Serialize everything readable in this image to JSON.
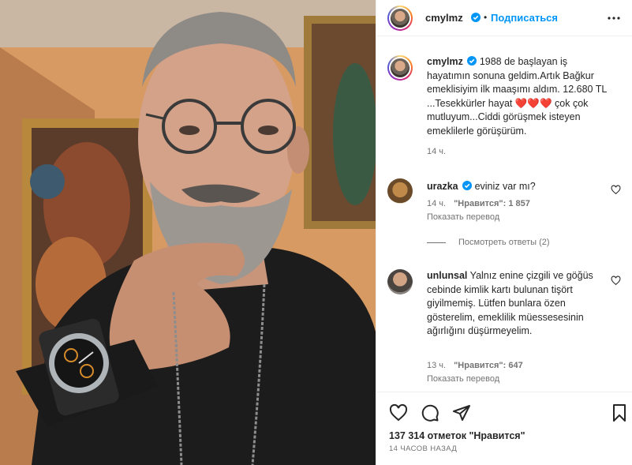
{
  "post": {
    "author": "cmylmz",
    "follow_label": "Подписаться",
    "dot": "•",
    "caption": "1988 de başlayan iş hayatımın sonuna geldim.Artık Bağkur emeklisiyim ilk maaşımı aldım. 12.680 TL ...Tesekkürler hayat ❤️❤️❤️ çok çok mutluyum...Ciddi görüşmek isteyen emeklilerle görüşürüm.",
    "caption_time": "14 ч.",
    "likes": "137 314 отметок \"Нравится\"",
    "posted_ago": "14 ЧАСОВ НАЗАД"
  },
  "comments": [
    {
      "user": "urazka",
      "verified": true,
      "text": "eviniz var mı?",
      "time": "14 ч.",
      "likes": "\"Нравится\": 1 857",
      "translate": "Показать перевод",
      "replies": "Посмотреть ответы (2)"
    },
    {
      "user": "unlunsal",
      "verified": false,
      "text": "Yalnız enine çizgili ve göğüs cebinde kimlik kartı bulunan tişört giyilmemiş. Lütfen bunlara özen gösterelim, emeklilik müessesesinin ağırlığını düşürmeyelim.",
      "time": "13 ч.",
      "likes": "\"Нравится\": 647",
      "translate": "Показать перевод"
    }
  ],
  "colors": {
    "accent": "#0095f6",
    "verified": "#0095f6",
    "text": "#262626",
    "muted": "#737373",
    "border": "#efefef"
  },
  "icons": [
    "more-options-icon",
    "verified-icon",
    "heart-icon",
    "comment-icon",
    "share-icon",
    "bookmark-icon",
    "like-comment-icon"
  ]
}
